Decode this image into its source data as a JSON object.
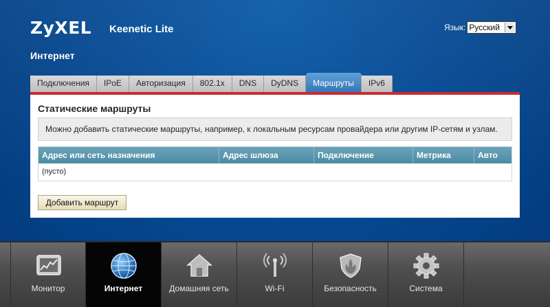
{
  "header": {
    "logo": "ZyXEL",
    "model": "Keenetic Lite",
    "language_label": "Язык:",
    "language_value": "Русский",
    "section_title": "Интернет"
  },
  "tabs": [
    {
      "label": "Подключения",
      "active": false
    },
    {
      "label": "IPoE",
      "active": false
    },
    {
      "label": "Авторизация",
      "active": false
    },
    {
      "label": "802.1x",
      "active": false
    },
    {
      "label": "DNS",
      "active": false
    },
    {
      "label": "DyDNS",
      "active": false
    },
    {
      "label": "Маршруты",
      "active": true
    },
    {
      "label": "IPv6",
      "active": false
    }
  ],
  "panel": {
    "title": "Статические маршруты",
    "info": "Можно добавить статические маршруты, например, к локальным ресурсам провайдера или другим IP-сетям и узлам.",
    "table": {
      "columns": [
        "Адрес или сеть назначения",
        "Адрес шлюза",
        "Подключение",
        "Метрика",
        "Авто"
      ],
      "empty_text": "(пусто)"
    },
    "add_button": "Добавить маршрут"
  },
  "nav": [
    {
      "label": "Монитор",
      "icon": "monitor-icon",
      "active": false
    },
    {
      "label": "Интернет",
      "icon": "globe-icon",
      "active": true
    },
    {
      "label": "Домашняя сеть",
      "icon": "home-icon",
      "active": false
    },
    {
      "label": "Wi-Fi",
      "icon": "wifi-icon",
      "active": false
    },
    {
      "label": "Безопасность",
      "icon": "shield-icon",
      "active": false
    },
    {
      "label": "Система",
      "icon": "gear-icon",
      "active": false
    }
  ],
  "colors": {
    "background": "#064a93",
    "tab_active": "#2f74b6",
    "tab_underline": "#c8262b",
    "table_header": "#5a95ad",
    "nav_active": "#050505"
  }
}
